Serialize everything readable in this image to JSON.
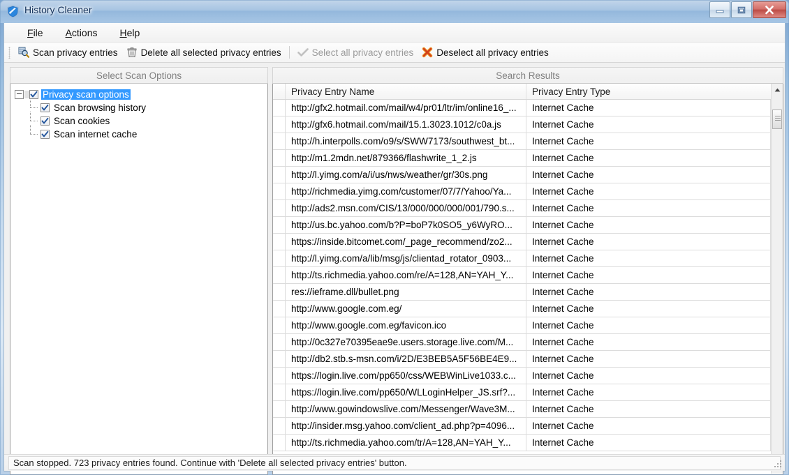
{
  "window": {
    "title": "History Cleaner",
    "icon": "shield-icon",
    "controls": {
      "minimize": "Minimize",
      "maximize": "Maximize",
      "close": "Close"
    }
  },
  "menu": {
    "items": [
      {
        "label": "File",
        "accesskey": "F"
      },
      {
        "label": "Actions",
        "accesskey": "A"
      },
      {
        "label": "Help",
        "accesskey": "H"
      }
    ]
  },
  "toolbar": {
    "buttons": [
      {
        "label": "Scan privacy entries",
        "icon": "scan-magnifier-icon",
        "disabled": false
      },
      {
        "label": "Delete all selected privacy entries",
        "icon": "trash-icon",
        "disabled": false
      },
      {
        "label": "Select all privacy entries",
        "icon": "checkmark-icon",
        "disabled": true
      },
      {
        "label": "Deselect all privacy entries",
        "icon": "red-x-icon",
        "disabled": false
      }
    ]
  },
  "left_panel": {
    "header": "Select Scan Options",
    "tree": {
      "root": {
        "label": "Privacy scan options",
        "checked": true,
        "selected": true,
        "expanded": true
      },
      "children": [
        {
          "label": "Scan browsing history",
          "checked": true
        },
        {
          "label": "Scan cookies",
          "checked": true
        },
        {
          "label": "Scan internet cache",
          "checked": true
        }
      ]
    }
  },
  "right_panel": {
    "header": "Search Results",
    "columns": [
      "",
      "Privacy Entry Name",
      "Privacy Entry Type"
    ],
    "rows": [
      [
        "http://gfx2.hotmail.com/mail/w4/pr01/ltr/im/online16_...",
        "Internet Cache"
      ],
      [
        "http://gfx6.hotmail.com/mail/15.1.3023.1012/c0a.js",
        "Internet Cache"
      ],
      [
        "http://h.interpolls.com/o9/s/SWW7173/southwest_bt...",
        "Internet Cache"
      ],
      [
        "http://m1.2mdn.net/879366/flashwrite_1_2.js",
        "Internet Cache"
      ],
      [
        "http://l.yimg.com/a/i/us/nws/weather/gr/30s.png",
        "Internet Cache"
      ],
      [
        "http://richmedia.yimg.com/customer/07/7/Yahoo/Ya...",
        "Internet Cache"
      ],
      [
        "http://ads2.msn.com/CIS/13/000/000/000/001/790.s...",
        "Internet Cache"
      ],
      [
        "http://us.bc.yahoo.com/b?P=boP7k0SO5_y6WyRO...",
        "Internet Cache"
      ],
      [
        "https://inside.bitcomet.com/_page_recommend/zo2...",
        "Internet Cache"
      ],
      [
        "http://l.yimg.com/a/lib/msg/js/clientad_rotator_0903...",
        "Internet Cache"
      ],
      [
        "http://ts.richmedia.yahoo.com/re/A=128,AN=YAH_Y...",
        "Internet Cache"
      ],
      [
        "res://ieframe.dll/bullet.png",
        "Internet Cache"
      ],
      [
        "http://www.google.com.eg/",
        "Internet Cache"
      ],
      [
        "http://www.google.com.eg/favicon.ico",
        "Internet Cache"
      ],
      [
        "http://0c327e70395eae9e.users.storage.live.com/M...",
        "Internet Cache"
      ],
      [
        "http://db2.stb.s-msn.com/i/2D/E3BEB5A5F56BE4E9...",
        "Internet Cache"
      ],
      [
        "https://login.live.com/pp650/css/WEBWinLive1033.c...",
        "Internet Cache"
      ],
      [
        "https://login.live.com/pp650/WLLoginHelper_JS.srf?...",
        "Internet Cache"
      ],
      [
        "http://www.gowindowslive.com/Messenger/Wave3M...",
        "Internet Cache"
      ],
      [
        "http://insider.msg.yahoo.com/client_ad.php?p=4096...",
        "Internet Cache"
      ],
      [
        "http://ts.richmedia.yahoo.com/tr/A=128,AN=YAH_Y...",
        "Internet Cache"
      ]
    ],
    "scrollbar": {
      "position_percent": 4
    }
  },
  "statusbar": {
    "text": "Scan stopped. 723 privacy entries found. Continue with 'Delete all selected privacy entries' button.",
    "entries_found": 723
  },
  "colors": {
    "selection_blue": "#3399ff",
    "title_text": "#11305a",
    "disabled_text": "#9a9a9a",
    "close_red": "#bc4c46",
    "deselect_orange": "#e8611a"
  }
}
